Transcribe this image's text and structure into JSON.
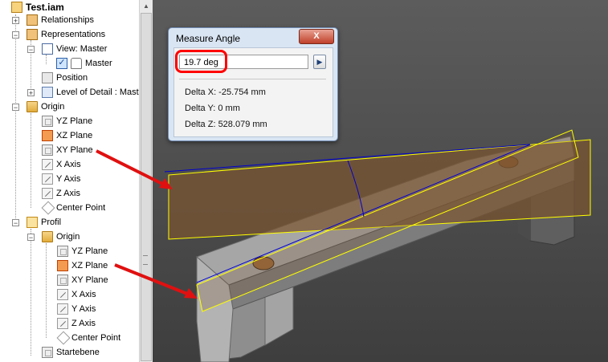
{
  "browser": {
    "root_label": "Test.iam",
    "items": [
      {
        "label": "Relationships"
      },
      {
        "label": "Representations"
      },
      {
        "label": "View: Master"
      },
      {
        "label": "Master"
      },
      {
        "label": "Position"
      },
      {
        "label": "Level of Detail : Mast"
      },
      {
        "label": "Origin"
      },
      {
        "label": "YZ Plane"
      },
      {
        "label": "XZ Plane"
      },
      {
        "label": "XY Plane"
      },
      {
        "label": "X Axis"
      },
      {
        "label": "Y Axis"
      },
      {
        "label": "Z Axis"
      },
      {
        "label": "Center Point"
      },
      {
        "label": "Profil"
      },
      {
        "label": "Origin"
      },
      {
        "label": "YZ Plane"
      },
      {
        "label": "XZ Plane"
      },
      {
        "label": "XY Plane"
      },
      {
        "label": "X Axis"
      },
      {
        "label": "Y Axis"
      },
      {
        "label": "Z Axis"
      },
      {
        "label": "Center Point"
      },
      {
        "label": "Startebene"
      }
    ],
    "icons": [
      "assembly-icon",
      "relationships-icon",
      "representations-icon",
      "view-icon",
      "check-icon",
      "lock-icon",
      "position-icon",
      "level-of-detail-icon",
      "folder-icon",
      "plane-icon",
      "xz-plane-selected-icon",
      "axis-icon",
      "center-point-icon",
      "part-icon"
    ]
  },
  "dialog": {
    "title": "Measure Angle",
    "close_label": "X",
    "value": "19.7 deg",
    "expand_label": "▶",
    "delta_x": "Delta X: -25.754 mm",
    "delta_y": "Delta Y: 0 mm",
    "delta_z": "Delta Z: 528.079 mm"
  },
  "colors": {
    "viewport_top": "#5c5c5c",
    "viewport_bottom": "#3e3e3e",
    "plane_fill": "#7a5530",
    "plane_edge": "#ffff00",
    "measure_line": "#0000cc",
    "annotation_arrow": "#e01010",
    "highlight_box": "#ff0000",
    "dialog_bg": "#d9e5f3"
  }
}
